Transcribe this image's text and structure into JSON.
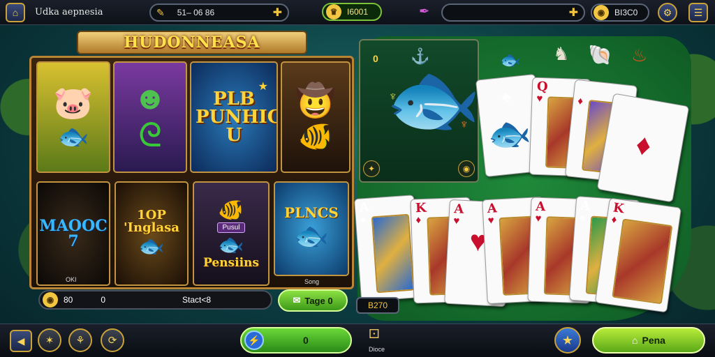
{
  "topbar": {
    "title": "Udka aepnesia",
    "date_value": "51– 06 86",
    "coins_value": "I6001",
    "balance_value": "",
    "gems_value": "BI3C0",
    "icons": [
      "home-icon",
      "ticket-icon",
      "gold-crown-icon",
      "feather-quill-icon",
      "plus-icon",
      "coin-stack-icon",
      "settings-icon",
      "menu-icon"
    ]
  },
  "slot": {
    "banner": "HUDONNEASA",
    "tiles": [
      {
        "label": ""
      },
      {
        "label": ""
      },
      {
        "label": "PLB PUNHIG U"
      },
      {
        "label": ""
      },
      {
        "label": "MAOOC 7"
      },
      {
        "label": "1OP 'Inglasa"
      },
      {
        "label": "Pensiins"
      },
      {
        "label": "PLNCS"
      }
    ],
    "tile3_tag": "Pusul",
    "small_tag_left": "OKI",
    "small_tag_right": "Song",
    "status": {
      "coin_value": "80",
      "count_value": "0",
      "stack_text": "Stact<8"
    },
    "action_button": "Tage 0"
  },
  "table": {
    "fish_panel_label": "0",
    "score_value": "B270",
    "top_row_cards": [
      {
        "rank": "",
        "suit": "♠",
        "color": "#111111"
      },
      {
        "rank": "Q",
        "suit": "♥",
        "color": "#c8102e"
      },
      {
        "rank": "",
        "suit": "♦",
        "color": "#c8102e"
      },
      {
        "rank": "",
        "suit": "♦",
        "color": "#c8102e"
      }
    ],
    "bottom_row_cards": [
      {
        "rank": "A",
        "suit": "♠",
        "color": "#111111"
      },
      {
        "rank": "K",
        "suit": "♦",
        "color": "#c8102e"
      },
      {
        "rank": "A",
        "suit": "♥",
        "color": "#c8102e"
      },
      {
        "rank": "A",
        "suit": "♥",
        "color": "#c8102e"
      },
      {
        "rank": "A",
        "suit": "♥",
        "color": "#c8102e"
      },
      {
        "rank": "A",
        "suit": "♠",
        "color": "#111111"
      },
      {
        "rank": "K",
        "suit": "♦",
        "color": "#c8102e"
      }
    ]
  },
  "bottombar": {
    "center_value": "0",
    "dice_label": "Dioce",
    "play_button": "Pena"
  }
}
